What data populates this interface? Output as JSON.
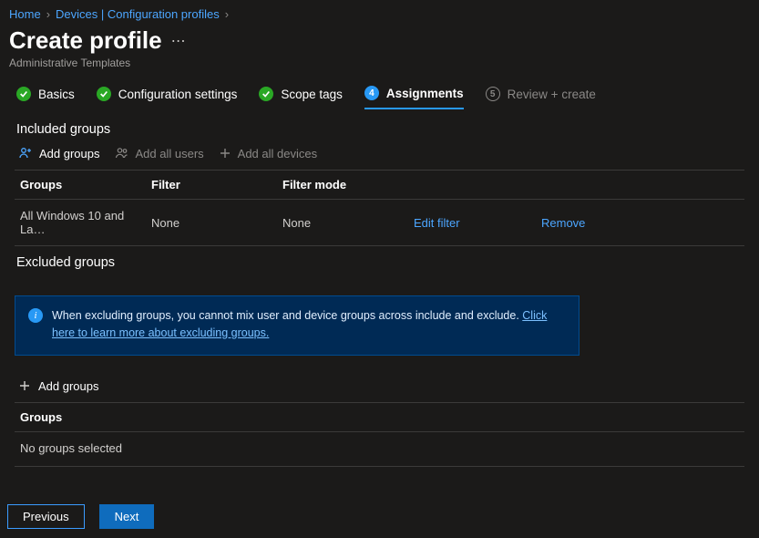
{
  "breadcrumb": [
    {
      "label": "Home"
    },
    {
      "label": "Devices | Configuration profiles"
    }
  ],
  "header": {
    "title": "Create profile",
    "subtitle": "Administrative Templates"
  },
  "steps": [
    {
      "label": "Basics",
      "state": "done"
    },
    {
      "label": "Configuration settings",
      "state": "done"
    },
    {
      "label": "Scope tags",
      "state": "done"
    },
    {
      "label": "Assignments",
      "state": "current",
      "num": "4"
    },
    {
      "label": "Review + create",
      "state": "future",
      "num": "5"
    }
  ],
  "included": {
    "heading": "Included groups",
    "actions": {
      "add_groups": "Add groups",
      "add_all_users": "Add all users",
      "add_all_devices": "Add all devices"
    },
    "columns": {
      "groups": "Groups",
      "filter": "Filter",
      "filter_mode": "Filter mode"
    },
    "row": {
      "groups": "All Windows 10 and La…",
      "filter": "None",
      "filter_mode": "None",
      "edit": "Edit filter",
      "remove": "Remove"
    }
  },
  "excluded": {
    "heading": "Excluded groups",
    "info_text": "When excluding groups, you cannot mix user and device groups across include and exclude. ",
    "info_link": "Click here to learn more about excluding groups.",
    "add_groups": "Add groups",
    "columns": {
      "groups": "Groups"
    },
    "empty": "No groups selected"
  },
  "footer": {
    "previous": "Previous",
    "next": "Next"
  }
}
